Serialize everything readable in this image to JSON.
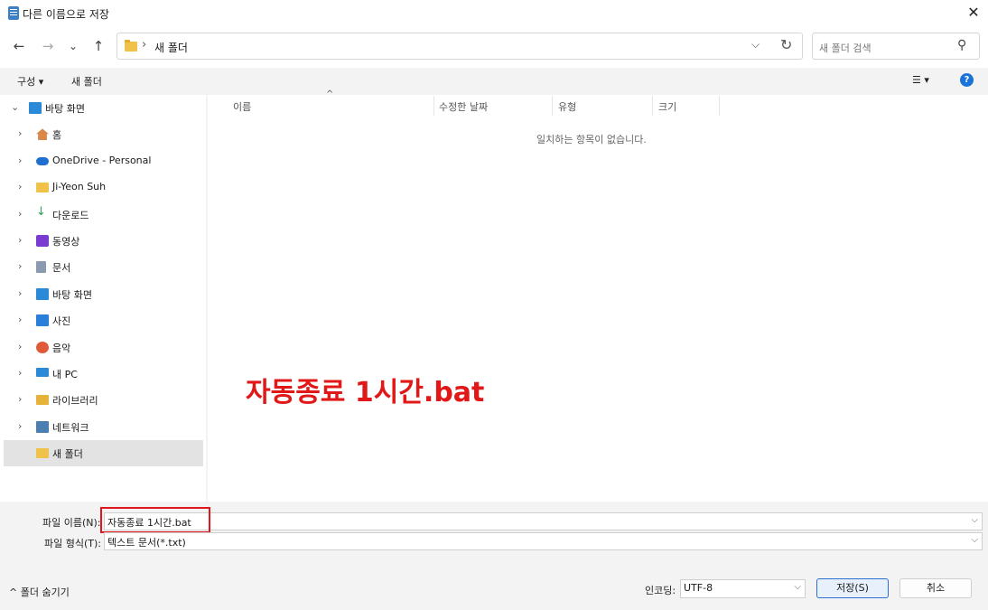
{
  "window": {
    "title": "다른 이름으로 저장",
    "close_icon": "✕"
  },
  "nav": {
    "back": "←",
    "forward": "→",
    "recent": "⌄",
    "up": "↑"
  },
  "address": {
    "separator": "›",
    "path": "새 폴더",
    "dropdown": "⌵",
    "refresh": "↻"
  },
  "search": {
    "placeholder": "새 폴더 검색",
    "icon": "⚲"
  },
  "commands": {
    "organize": "구성 ▾",
    "new_folder": "새 폴더",
    "view": "☰ ▾",
    "help": "?"
  },
  "sidebar": {
    "items": [
      {
        "label": "바탕 화면",
        "icon": "desktop-icon",
        "chevron": "⌄",
        "indent": 0
      },
      {
        "label": "홈",
        "icon": "home-icon",
        "chevron": "›",
        "indent": 1
      },
      {
        "label": "OneDrive - Personal",
        "icon": "cloud-icon",
        "chevron": "›",
        "indent": 1
      },
      {
        "label": "Ji-Yeon Suh",
        "icon": "folder-icon",
        "chevron": "›",
        "indent": 1
      },
      {
        "label": "다운로드",
        "icon": "download-icon",
        "chevron": "›",
        "indent": 1
      },
      {
        "label": "동영상",
        "icon": "video-icon",
        "chevron": "›",
        "indent": 1
      },
      {
        "label": "문서",
        "icon": "document-icon",
        "chevron": "›",
        "indent": 1
      },
      {
        "label": "바탕 화면",
        "icon": "desktop-icon",
        "chevron": "›",
        "indent": 1
      },
      {
        "label": "사진",
        "icon": "pictures-icon",
        "chevron": "›",
        "indent": 1
      },
      {
        "label": "음악",
        "icon": "music-icon",
        "chevron": "›",
        "indent": 1
      },
      {
        "label": "내 PC",
        "icon": "pc-icon",
        "chevron": "›",
        "indent": 1
      },
      {
        "label": "라이브러리",
        "icon": "library-icon",
        "chevron": "›",
        "indent": 1
      },
      {
        "label": "네트워크",
        "icon": "network-icon",
        "chevron": "›",
        "indent": 1
      },
      {
        "label": "새 폴더",
        "icon": "folder-icon",
        "chevron": "",
        "indent": 1,
        "selected": true
      }
    ]
  },
  "columns": {
    "name": "이름",
    "modified": "수정한 날짜",
    "type": "유형",
    "size": "크기",
    "sort_indicator": "^"
  },
  "empty_message": "일치하는 항목이 없습니다.",
  "overlay_text": "자동종료 1시간.bat",
  "form": {
    "filename_label": "파일 이름(N):",
    "filename_value": "자동종료 1시간.bat",
    "filetype_label": "파일 형식(T):",
    "filetype_value": "텍스트 문서(*.txt)",
    "dropdown": "⌵"
  },
  "footer": {
    "hide_folders": "^ 폴더 숨기기",
    "encoding_label": "인코딩:",
    "encoding_value": "UTF-8",
    "save_button": "저장(S)",
    "cancel_button": "취소"
  }
}
